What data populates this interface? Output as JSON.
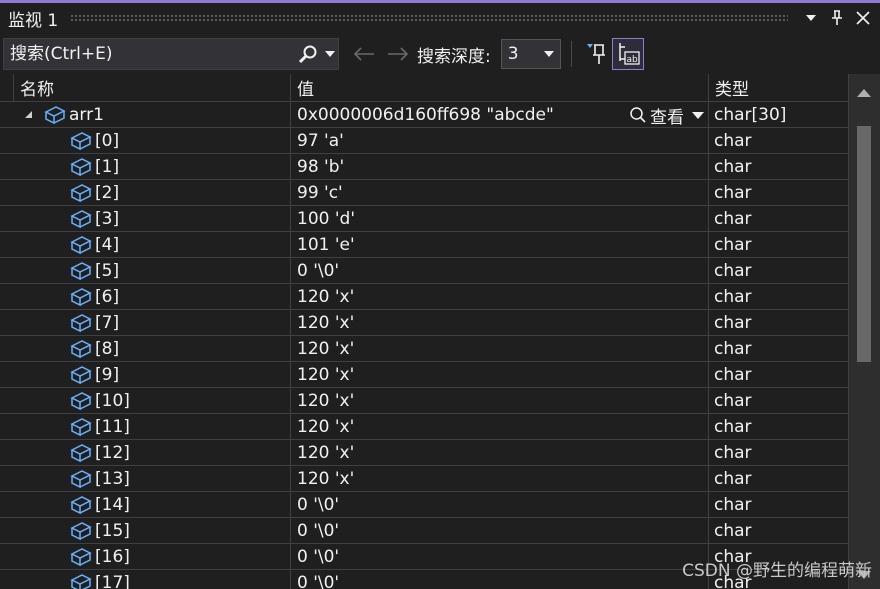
{
  "window": {
    "title": "监视 1"
  },
  "toolbar": {
    "search_placeholder": "搜索(Ctrl+E)",
    "depth_label": "搜索深度:",
    "depth_value": "3"
  },
  "grid": {
    "headers": [
      "名称",
      "值",
      "类型"
    ],
    "root": {
      "name": "arr1",
      "value": "0x0000006d160ff698 \"abcde\"",
      "type": "char[30]",
      "view_label": "查看"
    },
    "rows": [
      {
        "name": "[0]",
        "value": "97 'a'",
        "type": "char"
      },
      {
        "name": "[1]",
        "value": "98 'b'",
        "type": "char"
      },
      {
        "name": "[2]",
        "value": "99 'c'",
        "type": "char"
      },
      {
        "name": "[3]",
        "value": "100 'd'",
        "type": "char"
      },
      {
        "name": "[4]",
        "value": "101 'e'",
        "type": "char"
      },
      {
        "name": "[5]",
        "value": "0 '\\0'",
        "type": "char"
      },
      {
        "name": "[6]",
        "value": "120 'x'",
        "type": "char"
      },
      {
        "name": "[7]",
        "value": "120 'x'",
        "type": "char"
      },
      {
        "name": "[8]",
        "value": "120 'x'",
        "type": "char"
      },
      {
        "name": "[9]",
        "value": "120 'x'",
        "type": "char"
      },
      {
        "name": "[10]",
        "value": "120 'x'",
        "type": "char"
      },
      {
        "name": "[11]",
        "value": "120 'x'",
        "type": "char"
      },
      {
        "name": "[12]",
        "value": "120 'x'",
        "type": "char"
      },
      {
        "name": "[13]",
        "value": "120 'x'",
        "type": "char"
      },
      {
        "name": "[14]",
        "value": "0 '\\0'",
        "type": "char"
      },
      {
        "name": "[15]",
        "value": "0 '\\0'",
        "type": "char"
      },
      {
        "name": "[16]",
        "value": "0 '\\0'",
        "type": "char"
      },
      {
        "name": "[17]",
        "value": "0 '\\0'",
        "type": "char"
      }
    ]
  },
  "watermark": "CSDN @野生的编程萌新",
  "icons": {
    "window_menu": "chevron-down-icon",
    "pin": "pin-icon",
    "close": "close-icon",
    "search": "search-icon",
    "nav_back": "arrow-left-icon",
    "nav_forward": "arrow-right-icon",
    "pin_watch": "pin-watch-icon",
    "hex_display": "ab-display-icon",
    "object": "cube-object-icon"
  },
  "colors": {
    "accent": "#8f7bd4",
    "background": "#1f1f1f",
    "object_icon": "#6ab0ff"
  }
}
